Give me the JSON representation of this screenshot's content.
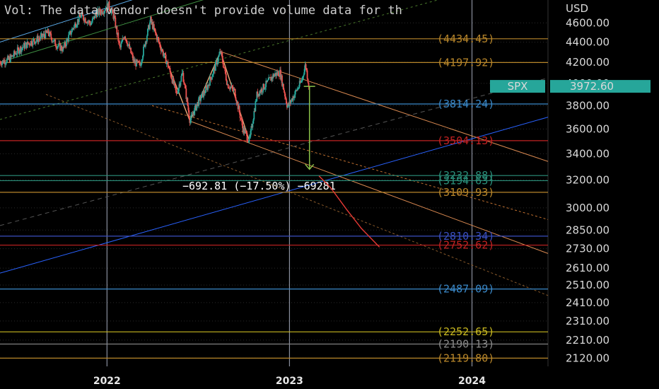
{
  "chart_data": {
    "type": "candlestick",
    "symbol": "SPX",
    "currency_label": "USD",
    "last_price": "3972.60",
    "volume_notice": "Vol: The data vendor doesn't provide volume data for th",
    "y_axis": {
      "scale": "log",
      "range": [
        2080,
        4850
      ],
      "ticks": [
        "4600.00",
        "4400.00",
        "4200.00",
        "4000.00",
        "3800.00",
        "3600.00",
        "3400.00",
        "3200.00",
        "3000.00",
        "2850.00",
        "2730.00",
        "2610.00",
        "2510.00",
        "2410.00",
        "2310.00",
        "2210.00",
        "2120.00"
      ]
    },
    "x_axis": {
      "type": "date",
      "range": [
        "2021-06-01",
        "2024-06-01"
      ],
      "labels": [
        {
          "text": "2022",
          "date": "2022-01-01"
        },
        {
          "text": "2023",
          "date": "2023-01-01"
        },
        {
          "text": "2024",
          "date": "2024-01-01"
        }
      ]
    },
    "price_path": [
      [
        "2021-06-01",
        4200
      ],
      [
        "2021-06-20",
        4230
      ],
      [
        "2021-07-10",
        4330
      ],
      [
        "2021-08-01",
        4400
      ],
      [
        "2021-08-20",
        4440
      ],
      [
        "2021-09-05",
        4500
      ],
      [
        "2021-09-20",
        4380
      ],
      [
        "2021-10-05",
        4330
      ],
      [
        "2021-10-25",
        4550
      ],
      [
        "2021-11-10",
        4680
      ],
      [
        "2021-11-30",
        4590
      ],
      [
        "2021-12-10",
        4700
      ],
      [
        "2021-12-25",
        4740
      ],
      [
        "2022-01-04",
        4790
      ],
      [
        "2022-01-15",
        4660
      ],
      [
        "2022-01-27",
        4330
      ],
      [
        "2022-02-05",
        4480
      ],
      [
        "2022-02-24",
        4200
      ],
      [
        "2022-03-08",
        4170
      ],
      [
        "2022-03-29",
        4630
      ],
      [
        "2022-04-15",
        4390
      ],
      [
        "2022-05-03",
        4170
      ],
      [
        "2022-05-20",
        3900
      ],
      [
        "2022-06-01",
        4100
      ],
      [
        "2022-06-16",
        3666
      ],
      [
        "2022-07-01",
        3820
      ],
      [
        "2022-07-20",
        3960
      ],
      [
        "2022-08-05",
        4150
      ],
      [
        "2022-08-16",
        4305
      ],
      [
        "2022-08-30",
        3990
      ],
      [
        "2022-09-13",
        3930
      ],
      [
        "2022-09-30",
        3600
      ],
      [
        "2022-10-13",
        3500
      ],
      [
        "2022-10-28",
        3900
      ],
      [
        "2022-11-15",
        3990
      ],
      [
        "2022-12-01",
        4080
      ],
      [
        "2022-12-13",
        4100
      ],
      [
        "2022-12-28",
        3790
      ],
      [
        "2023-01-05",
        3850
      ],
      [
        "2023-01-25",
        4020
      ],
      [
        "2023-02-02",
        4180
      ],
      [
        "2023-02-09",
        3972.6
      ]
    ],
    "horizontal_levels": [
      {
        "value": 4434.45,
        "label": "(4434.45)",
        "color": "#b8862a"
      },
      {
        "value": 4197.92,
        "label": "(4197.92)",
        "color": "#b8862a"
      },
      {
        "value": 3814.24,
        "label": "(3814.24)",
        "color": "#3a88c8"
      },
      {
        "value": 3504.13,
        "label": "(3504.13)",
        "color": "#c22222"
      },
      {
        "value": 3232.88,
        "label": "(3232.88)",
        "color": "#2a8f7a"
      },
      {
        "value": 3194.63,
        "label": "(3194.63)",
        "color": "#2a8f7a"
      },
      {
        "value": 3109.93,
        "label": "(3109.93)",
        "color": "#b8862a"
      },
      {
        "value": 2810.34,
        "label": "(2810.34)",
        "color": "#3a4fc0"
      },
      {
        "value": 2752.62,
        "label": "(2752.62)",
        "color": "#c22222"
      },
      {
        "value": 2487.09,
        "label": "(2487.09)",
        "color": "#3a88c8"
      },
      {
        "value": 2252.65,
        "label": "(2252.65)",
        "color": "#c8b820"
      },
      {
        "value": 2190.13,
        "label": "(2190.13)",
        "color": "#8a8a8a"
      },
      {
        "value": 2119.8,
        "label": "(2119.80)",
        "color": "#b8862a"
      }
    ],
    "measurement": {
      "text": "−692.81 (−17.50%) −69281",
      "from": [
        "2023-02-10",
        3972.6
      ],
      "to": [
        "2023-02-10",
        3280
      ]
    },
    "projection_path": [
      [
        "2023-03-01",
        3230
      ],
      [
        "2023-03-25",
        3140
      ],
      [
        "2023-04-25",
        2990
      ],
      [
        "2023-05-25",
        2860
      ],
      [
        "2023-06-30",
        2740
      ]
    ],
    "colors": {
      "up": "#26a69a",
      "down": "#ef5350",
      "badge": "#26a69a",
      "measure_arrow": "#8bc34a",
      "projection": "#e53935"
    }
  }
}
